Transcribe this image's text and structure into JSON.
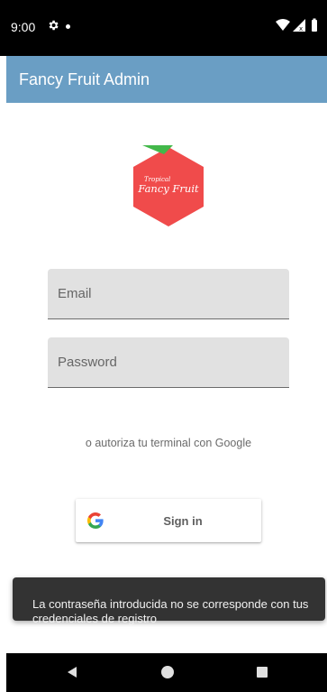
{
  "status_bar": {
    "time": "9:00",
    "icons": [
      "gear-icon",
      "notification-dot-icon",
      "wifi-icon",
      "signal-icon",
      "battery-icon"
    ]
  },
  "app_bar": {
    "title": "Fancy Fruit Admin",
    "color": "#6a9ec4"
  },
  "logo": {
    "line1": "Tropical",
    "line2": "Fancy Fruit",
    "fill": "#f04b4b",
    "leaf": "#43b84a"
  },
  "form": {
    "email_placeholder": "Email",
    "email_value": "",
    "password_placeholder": "Password",
    "password_value": ""
  },
  "google_hint": "o autoriza tu terminal con Google",
  "google_button": {
    "label": "Sign in",
    "icon": "google-g-icon"
  },
  "snackbar": {
    "message": "La contraseña introducida no se corresponde con tus credenciales de registro",
    "background": "#333333"
  },
  "nav_bar": {
    "icons": [
      "back-icon",
      "home-icon",
      "recents-icon"
    ]
  }
}
